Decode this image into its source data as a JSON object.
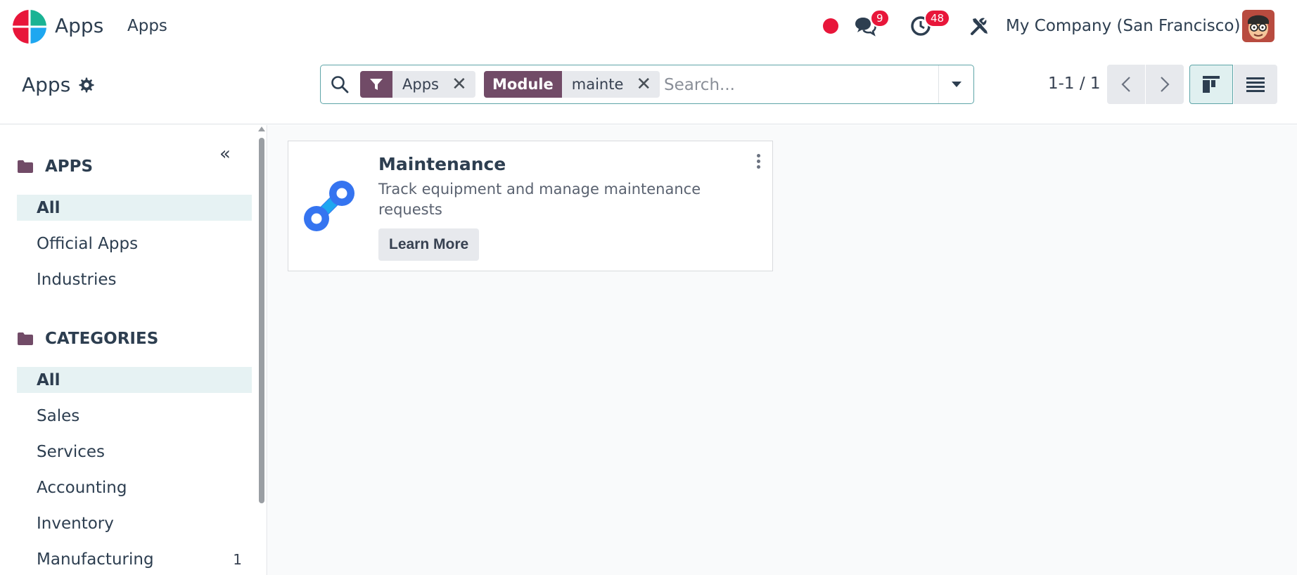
{
  "navbar": {
    "app_name": "Apps",
    "menu_item": "Apps",
    "messages_count": "9",
    "activities_count": "48",
    "company": "My Company (San Francisco)"
  },
  "control": {
    "breadcrumb": "Apps",
    "search": {
      "facet1_value": "Apps",
      "facet2_label": "Module",
      "facet2_value": "mainte",
      "placeholder": "Search..."
    },
    "pager": "1-1 / 1"
  },
  "sidebar": {
    "apps_heading": "APPS",
    "apps_items": [
      {
        "label": "All",
        "active": true
      },
      {
        "label": "Official Apps"
      },
      {
        "label": "Industries"
      }
    ],
    "categories_heading": "CATEGORIES",
    "category_items": [
      {
        "label": "All",
        "active": true
      },
      {
        "label": "Sales"
      },
      {
        "label": "Services"
      },
      {
        "label": "Accounting"
      },
      {
        "label": "Inventory"
      },
      {
        "label": "Manufacturing",
        "count": "1"
      }
    ]
  },
  "main": {
    "card": {
      "title": "Maintenance",
      "description": "Track equipment and manage maintenance requests",
      "button": "Learn More"
    }
  },
  "colors": {
    "brand": "#714b67",
    "badge": "#e8163a",
    "active_bg": "#e6f2f3",
    "search_border": "#5ea5a8",
    "card_icon": "#3574f0"
  }
}
